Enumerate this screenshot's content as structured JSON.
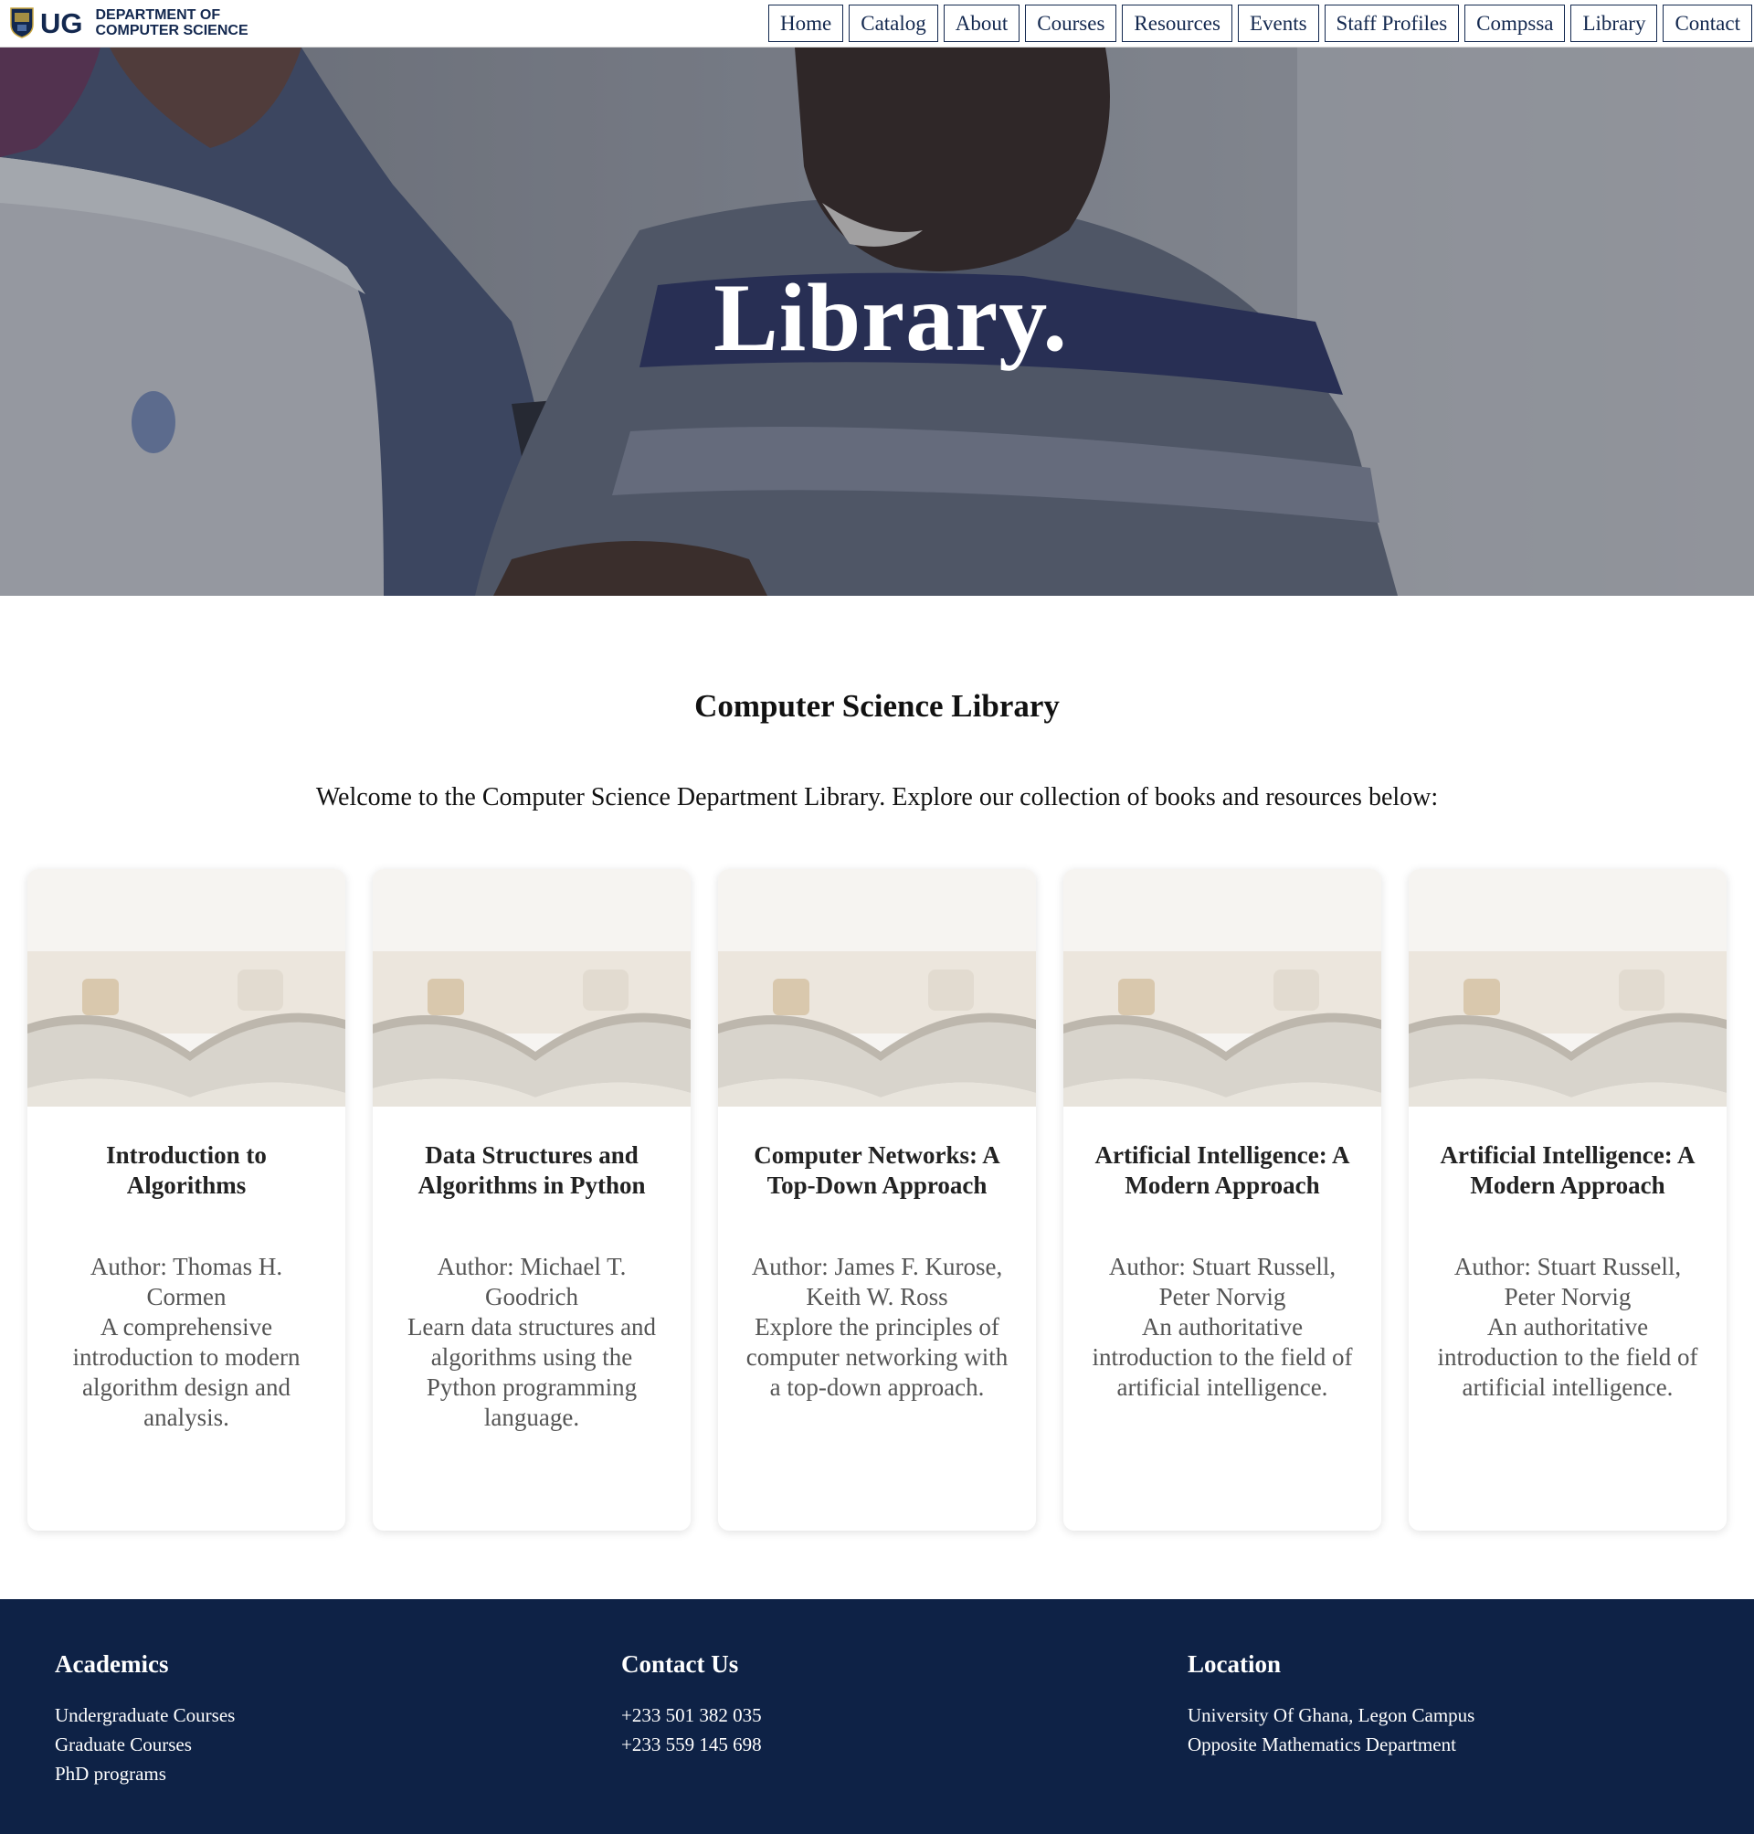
{
  "header": {
    "logo_short": "UG",
    "logo_line1": "DEPARTMENT OF",
    "logo_line2": "COMPUTER SCIENCE",
    "nav": [
      "Home",
      "Catalog",
      "About",
      "Courses",
      "Resources",
      "Events",
      "Staff Profiles",
      "Compssa",
      "Library",
      "Contact"
    ]
  },
  "hero": {
    "title": "Library."
  },
  "main": {
    "title": "Computer Science Library",
    "intro": "Welcome to the Computer Science Department Library. Explore our collection of books and resources below:",
    "books": [
      {
        "title": "Introduction to Algorithms",
        "author": "Author: Thomas H. Cormen",
        "description": "A comprehensive introduction to modern algorithm design and analysis."
      },
      {
        "title": "Data Structures and Algorithms in Python",
        "author": "Author: Michael T. Goodrich",
        "description": "Learn data structures and algorithms using the Python programming language."
      },
      {
        "title": "Computer Networks: A Top-Down Approach",
        "author": "Author: James F. Kurose, Keith W. Ross",
        "description": "Explore the principles of computer networking with a top-down approach."
      },
      {
        "title": "Artificial Intelligence: A Modern Approach",
        "author": "Author: Stuart Russell, Peter Norvig",
        "description": "An authoritative introduction to the field of artificial intelligence."
      },
      {
        "title": "Artificial Intelligence: A Modern Approach",
        "author": "Author: Stuart Russell, Peter Norvig",
        "description": "An authoritative introduction to the field of artificial intelligence."
      }
    ]
  },
  "footer": {
    "academics": {
      "heading": "Academics",
      "links": [
        "Undergraduate Courses",
        "Graduate Courses",
        "PhD programs"
      ]
    },
    "contact": {
      "heading": "Contact Us",
      "phones": [
        "+233 501 382 035",
        "+233 559 145 698"
      ]
    },
    "location": {
      "heading": "Location",
      "lines": [
        "University Of Ghana, Legon Campus",
        "Opposite Mathematics Department"
      ]
    }
  },
  "colors": {
    "brand_navy": "#13284f",
    "footer_bg": "#0e2246"
  }
}
